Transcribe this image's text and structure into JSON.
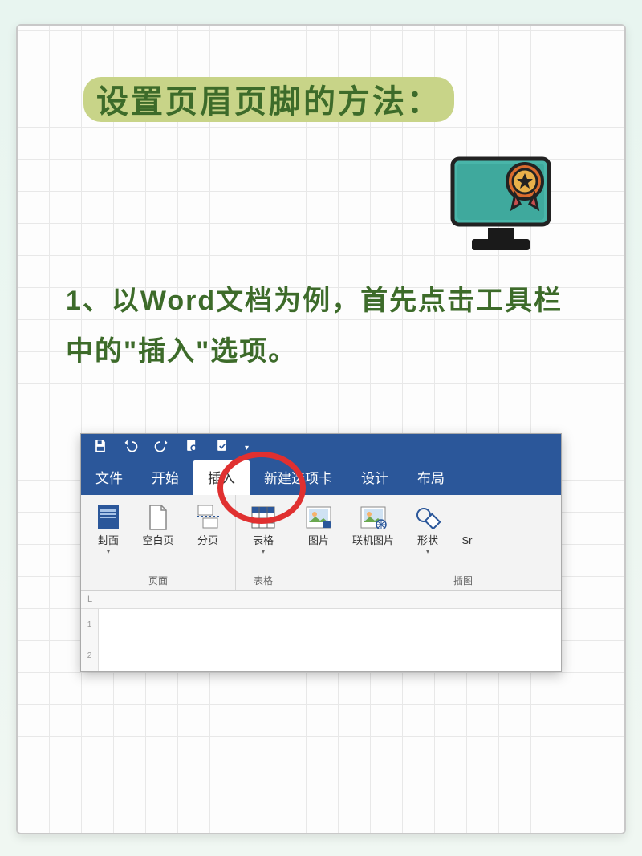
{
  "title": "设置页眉页脚的方法：",
  "step_text": "1、以Word文档为例，首先点击工具栏中的\"插入\"选项。",
  "word": {
    "menu": {
      "file": "文件",
      "home": "开始",
      "insert": "插入",
      "newtab": "新建选项卡",
      "design": "设计",
      "layout": "布局"
    },
    "groups": {
      "pages": {
        "label": "页面",
        "cover": "封面",
        "blank": "空白页",
        "break": "分页"
      },
      "tables": {
        "label": "表格",
        "table": "表格"
      },
      "illus": {
        "label": "插图",
        "picture": "图片",
        "online": "联机图片",
        "shapes": "形状",
        "smart": "Sr"
      }
    },
    "ruler_mark": "L",
    "vruler": [
      "1",
      "2"
    ]
  }
}
